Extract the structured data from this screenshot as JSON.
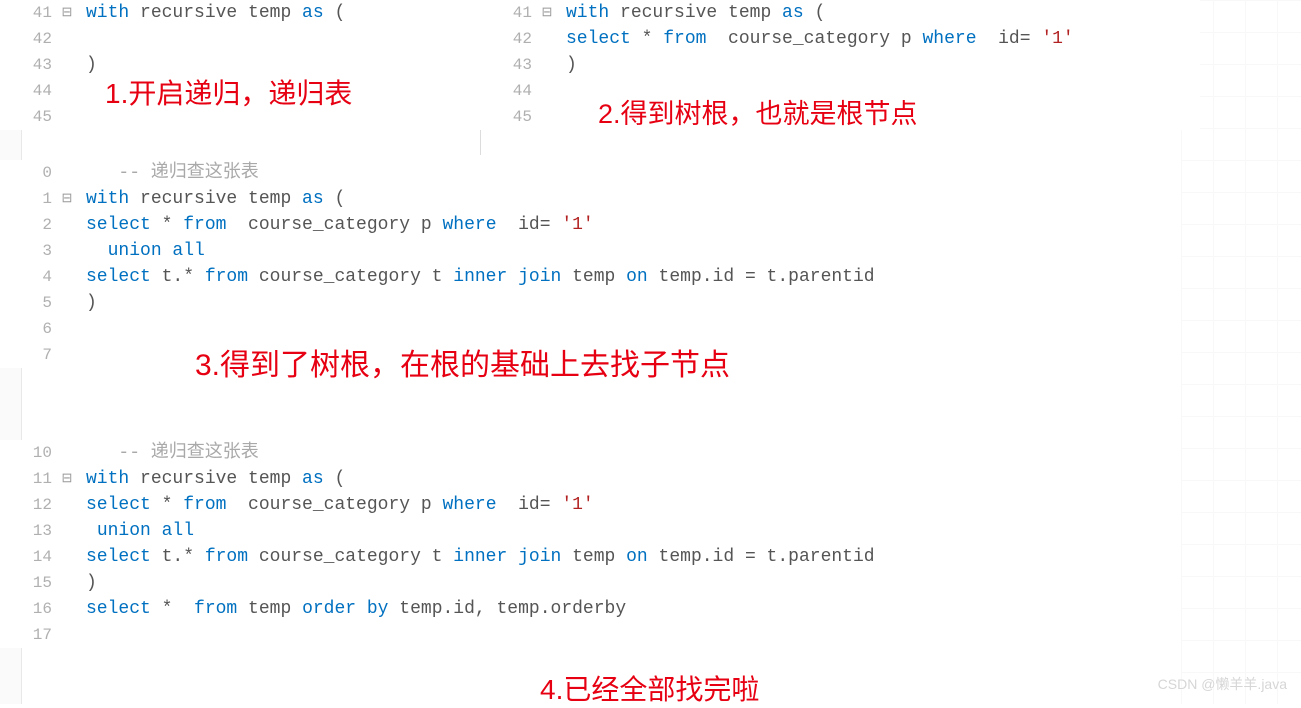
{
  "annotations": {
    "a1": "1.开启递归，递归表",
    "a2": "2.得到树根，也就是根节点",
    "a3": "3.得到了树根，在根的基础上去找子节点",
    "a4": "4.已经全部找完啦"
  },
  "pane_left_top": {
    "lines": [
      {
        "num": "41",
        "fold": "⊟",
        "guide": false,
        "tokens": [
          [
            "kw",
            "with"
          ],
          [
            "txt",
            " recursive temp "
          ],
          [
            "kw",
            "as"
          ],
          [
            "txt",
            " ("
          ]
        ]
      },
      {
        "num": "42",
        "fold": "",
        "guide": true,
        "tokens": []
      },
      {
        "num": "43",
        "fold": "",
        "guide": false,
        "tokens": [
          [
            "txt",
            ")"
          ]
        ]
      },
      {
        "num": "44",
        "fold": "",
        "guide": false,
        "tokens": []
      },
      {
        "num": "45",
        "fold": "",
        "guide": false,
        "tokens": []
      }
    ]
  },
  "pane_right_top": {
    "lines": [
      {
        "num": "41",
        "fold": "⊟",
        "guide": false,
        "tokens": [
          [
            "kw",
            "with"
          ],
          [
            "txt",
            " recursive temp "
          ],
          [
            "kw",
            "as"
          ],
          [
            "txt",
            " ("
          ]
        ]
      },
      {
        "num": "42",
        "fold": "",
        "guide": true,
        "tokens": [
          [
            "kw",
            "select"
          ],
          [
            "txt",
            " * "
          ],
          [
            "kw",
            "from"
          ],
          [
            "txt",
            "  course_category p "
          ],
          [
            "kw",
            "where"
          ],
          [
            "txt",
            "  id= "
          ],
          [
            "str",
            "'1'"
          ]
        ]
      },
      {
        "num": "43",
        "fold": "",
        "guide": false,
        "tokens": [
          [
            "txt",
            ")"
          ]
        ]
      },
      {
        "num": "44",
        "fold": "",
        "guide": false,
        "tokens": []
      },
      {
        "num": "45",
        "fold": "",
        "guide": false,
        "tokens": []
      }
    ]
  },
  "pane_middle": {
    "lines": [
      {
        "num": "0",
        "fold": "",
        "guide": false,
        "tokens": [
          [
            "txt",
            "   "
          ],
          [
            "comment",
            "-- 递归查这张表"
          ]
        ]
      },
      {
        "num": "1",
        "fold": "⊟",
        "guide": false,
        "tokens": [
          [
            "kw",
            "with"
          ],
          [
            "txt",
            " recursive temp "
          ],
          [
            "kw",
            "as"
          ],
          [
            "txt",
            " ("
          ]
        ]
      },
      {
        "num": "2",
        "fold": "",
        "guide": true,
        "tokens": [
          [
            "kw",
            "select"
          ],
          [
            "txt",
            " * "
          ],
          [
            "kw",
            "from"
          ],
          [
            "txt",
            "  course_category p "
          ],
          [
            "kw",
            "where"
          ],
          [
            "txt",
            "  id= "
          ],
          [
            "str",
            "'1'"
          ]
        ]
      },
      {
        "num": "3",
        "fold": "",
        "guide": true,
        "tokens": [
          [
            "txt",
            "  "
          ],
          [
            "kw",
            "union all"
          ]
        ]
      },
      {
        "num": "4",
        "fold": "",
        "guide": true,
        "tokens": [
          [
            "kw",
            "select"
          ],
          [
            "txt",
            " t.* "
          ],
          [
            "kw",
            "from"
          ],
          [
            "txt",
            " course_category t "
          ],
          [
            "kw",
            "inner join"
          ],
          [
            "txt",
            " temp "
          ],
          [
            "kw",
            "on"
          ],
          [
            "txt",
            " temp.id = t.parentid"
          ]
        ]
      },
      {
        "num": "5",
        "fold": "",
        "guide": false,
        "tokens": [
          [
            "txt",
            ")"
          ]
        ]
      },
      {
        "num": "6",
        "fold": "",
        "guide": false,
        "tokens": []
      },
      {
        "num": "7",
        "fold": "",
        "guide": false,
        "tokens": []
      }
    ]
  },
  "pane_bottom": {
    "lines": [
      {
        "num": "10",
        "fold": "",
        "guide": false,
        "tokens": [
          [
            "txt",
            "   "
          ],
          [
            "comment",
            "-- 递归查这张表"
          ]
        ]
      },
      {
        "num": "11",
        "fold": "⊟",
        "guide": false,
        "tokens": [
          [
            "kw",
            "with"
          ],
          [
            "txt",
            " recursive temp "
          ],
          [
            "kw",
            "as"
          ],
          [
            "txt",
            " ("
          ]
        ]
      },
      {
        "num": "12",
        "fold": "",
        "guide": true,
        "tokens": [
          [
            "kw",
            "select"
          ],
          [
            "txt",
            " * "
          ],
          [
            "kw",
            "from"
          ],
          [
            "txt",
            "  course_category p "
          ],
          [
            "kw",
            "where"
          ],
          [
            "txt",
            "  id= "
          ],
          [
            "str",
            "'1'"
          ]
        ]
      },
      {
        "num": "13",
        "fold": "",
        "guide": true,
        "tokens": [
          [
            "txt",
            " "
          ],
          [
            "kw",
            "union all"
          ]
        ]
      },
      {
        "num": "14",
        "fold": "",
        "guide": true,
        "tokens": [
          [
            "kw",
            "select"
          ],
          [
            "txt",
            " t.* "
          ],
          [
            "kw",
            "from"
          ],
          [
            "txt",
            " course_category t "
          ],
          [
            "kw",
            "inner join"
          ],
          [
            "txt",
            " temp "
          ],
          [
            "kw",
            "on"
          ],
          [
            "txt",
            " temp.id = t.parentid"
          ]
        ]
      },
      {
        "num": "15",
        "fold": "",
        "guide": false,
        "tokens": [
          [
            "txt",
            ")"
          ]
        ]
      },
      {
        "num": "16",
        "fold": "",
        "guide": false,
        "tokens": [
          [
            "kw",
            "select"
          ],
          [
            "txt",
            " *  "
          ],
          [
            "kw",
            "from"
          ],
          [
            "txt",
            " temp "
          ],
          [
            "kw",
            "order by"
          ],
          [
            "txt",
            " temp.id, temp.orderby"
          ]
        ]
      },
      {
        "num": "17",
        "fold": "",
        "guide": false,
        "tokens": []
      }
    ]
  },
  "watermark": "CSDN @懒羊羊.java"
}
